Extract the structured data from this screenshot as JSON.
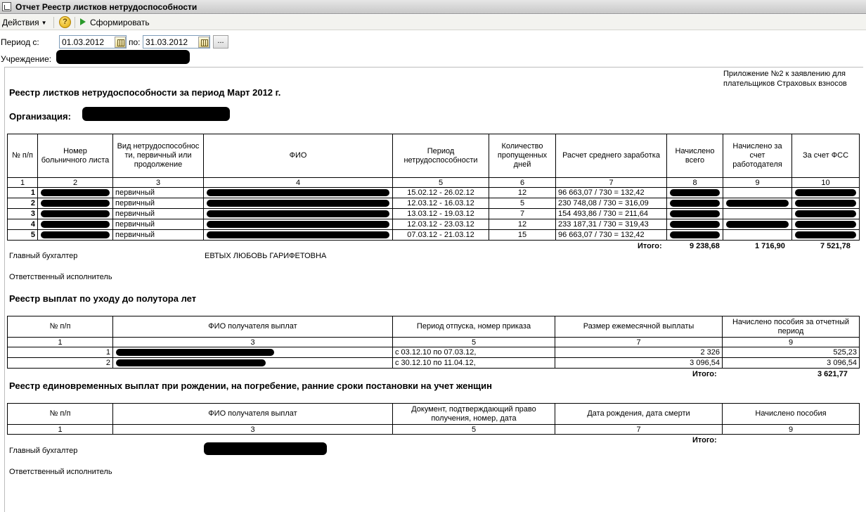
{
  "window": {
    "title": "Отчет  Реестр листков нетрудоспособности"
  },
  "toolbar": {
    "actions_label": "Действия",
    "help_label": "?",
    "run_label": "Сформировать"
  },
  "form": {
    "period_from_label": "Период с:",
    "period_from_value": "01.03.2012",
    "period_to_label": "по:",
    "period_to_value": "31.03.2012",
    "dots_label": "...",
    "institution_label": "Учреждение:"
  },
  "report": {
    "appendix_note": "Приложение №2 к заявлению для плательщиков Страховых взносов",
    "title": "Реестр листков нетрудоспособности за период  Март 2012 г.",
    "org_label": "Организация:",
    "t1": {
      "headers": [
        "№ п/п",
        "Номер больничного листа",
        "Вид нетрудоспособнос ти, первичный или продолжение",
        "ФИО",
        "Период нетрудоспособности",
        "Количество пропущенных дней",
        "Расчет среднего заработка",
        "Начислено всего",
        "Начислено за счет работодателя",
        "За счет ФСС"
      ],
      "nums": [
        "1",
        "2",
        "3",
        "4",
        "5",
        "6",
        "7",
        "8",
        "9",
        "10"
      ],
      "rows": [
        {
          "n": "1",
          "type": "первичный",
          "period": "15.02.12 - 26.02.12",
          "days": "12",
          "calc": "96 663,07 / 730 = 132,42"
        },
        {
          "n": "2",
          "type": "первичный",
          "period": "12.03.12 - 16.03.12",
          "days": "5",
          "calc": "230 748,08 / 730 = 316,09"
        },
        {
          "n": "3",
          "type": "первичный",
          "period": "13.03.12 - 19.03.12",
          "days": "7",
          "calc": "154 493,86 / 730 = 211,64"
        },
        {
          "n": "4",
          "type": "первичный",
          "period": "12.03.12 - 23.03.12",
          "days": "12",
          "calc": "233 187,31 / 730 = 319,43"
        },
        {
          "n": "5",
          "type": "первичный",
          "period": "07.03.12 - 21.03.12",
          "days": "15",
          "calc": "96 663,07 / 730 = 132,42"
        }
      ],
      "total_label": "Итого:",
      "total_all": "9 238,68",
      "total_employer": "1 716,90",
      "total_fss": "7 521,78"
    },
    "chief_accountant_label": "Главный бухгалтер",
    "chief_accountant_name": "ЕВТЫХ ЛЮБОВЬ ГАРИФЕТОВНА",
    "executor_label": "Ответственный исполнитель",
    "t2": {
      "title": "Реестр выплат по уходу до полутора лет",
      "headers": [
        "№ п/п",
        "ФИО получателя выплат",
        "Период отпуска, номер приказа",
        "Размер ежемесячной выплаты",
        "Начислено пособия за отчетный период"
      ],
      "nums": [
        "1",
        "3",
        "5",
        "7",
        "9"
      ],
      "rows": [
        {
          "n": "1",
          "period": "с 03.12.10 по 07.03.12,",
          "monthly": "2 326",
          "accrued": "525,23"
        },
        {
          "n": "2",
          "period": "с 30.12.10 по 11.04.12,",
          "monthly": "3 096,54",
          "accrued": "3 096,54"
        }
      ],
      "total_label": "Итого:",
      "total": "3 621,77"
    },
    "t3": {
      "title": "Реестр единовременных выплат при рождении, на погребение, ранние сроки постановки на учет женщин",
      "headers": [
        "№ п/п",
        "ФИО получателя выплат",
        "Документ, подтверждающий право получения, номер, дата",
        "Дата рождения, дата смерти",
        "Начислено пособия"
      ],
      "nums": [
        "1",
        "3",
        "5",
        "7",
        "9"
      ],
      "total_label": "Итого:"
    },
    "footer_chief_label": "Главный бухгалтер",
    "footer_executor_label": "Ответственный исполнитель"
  }
}
